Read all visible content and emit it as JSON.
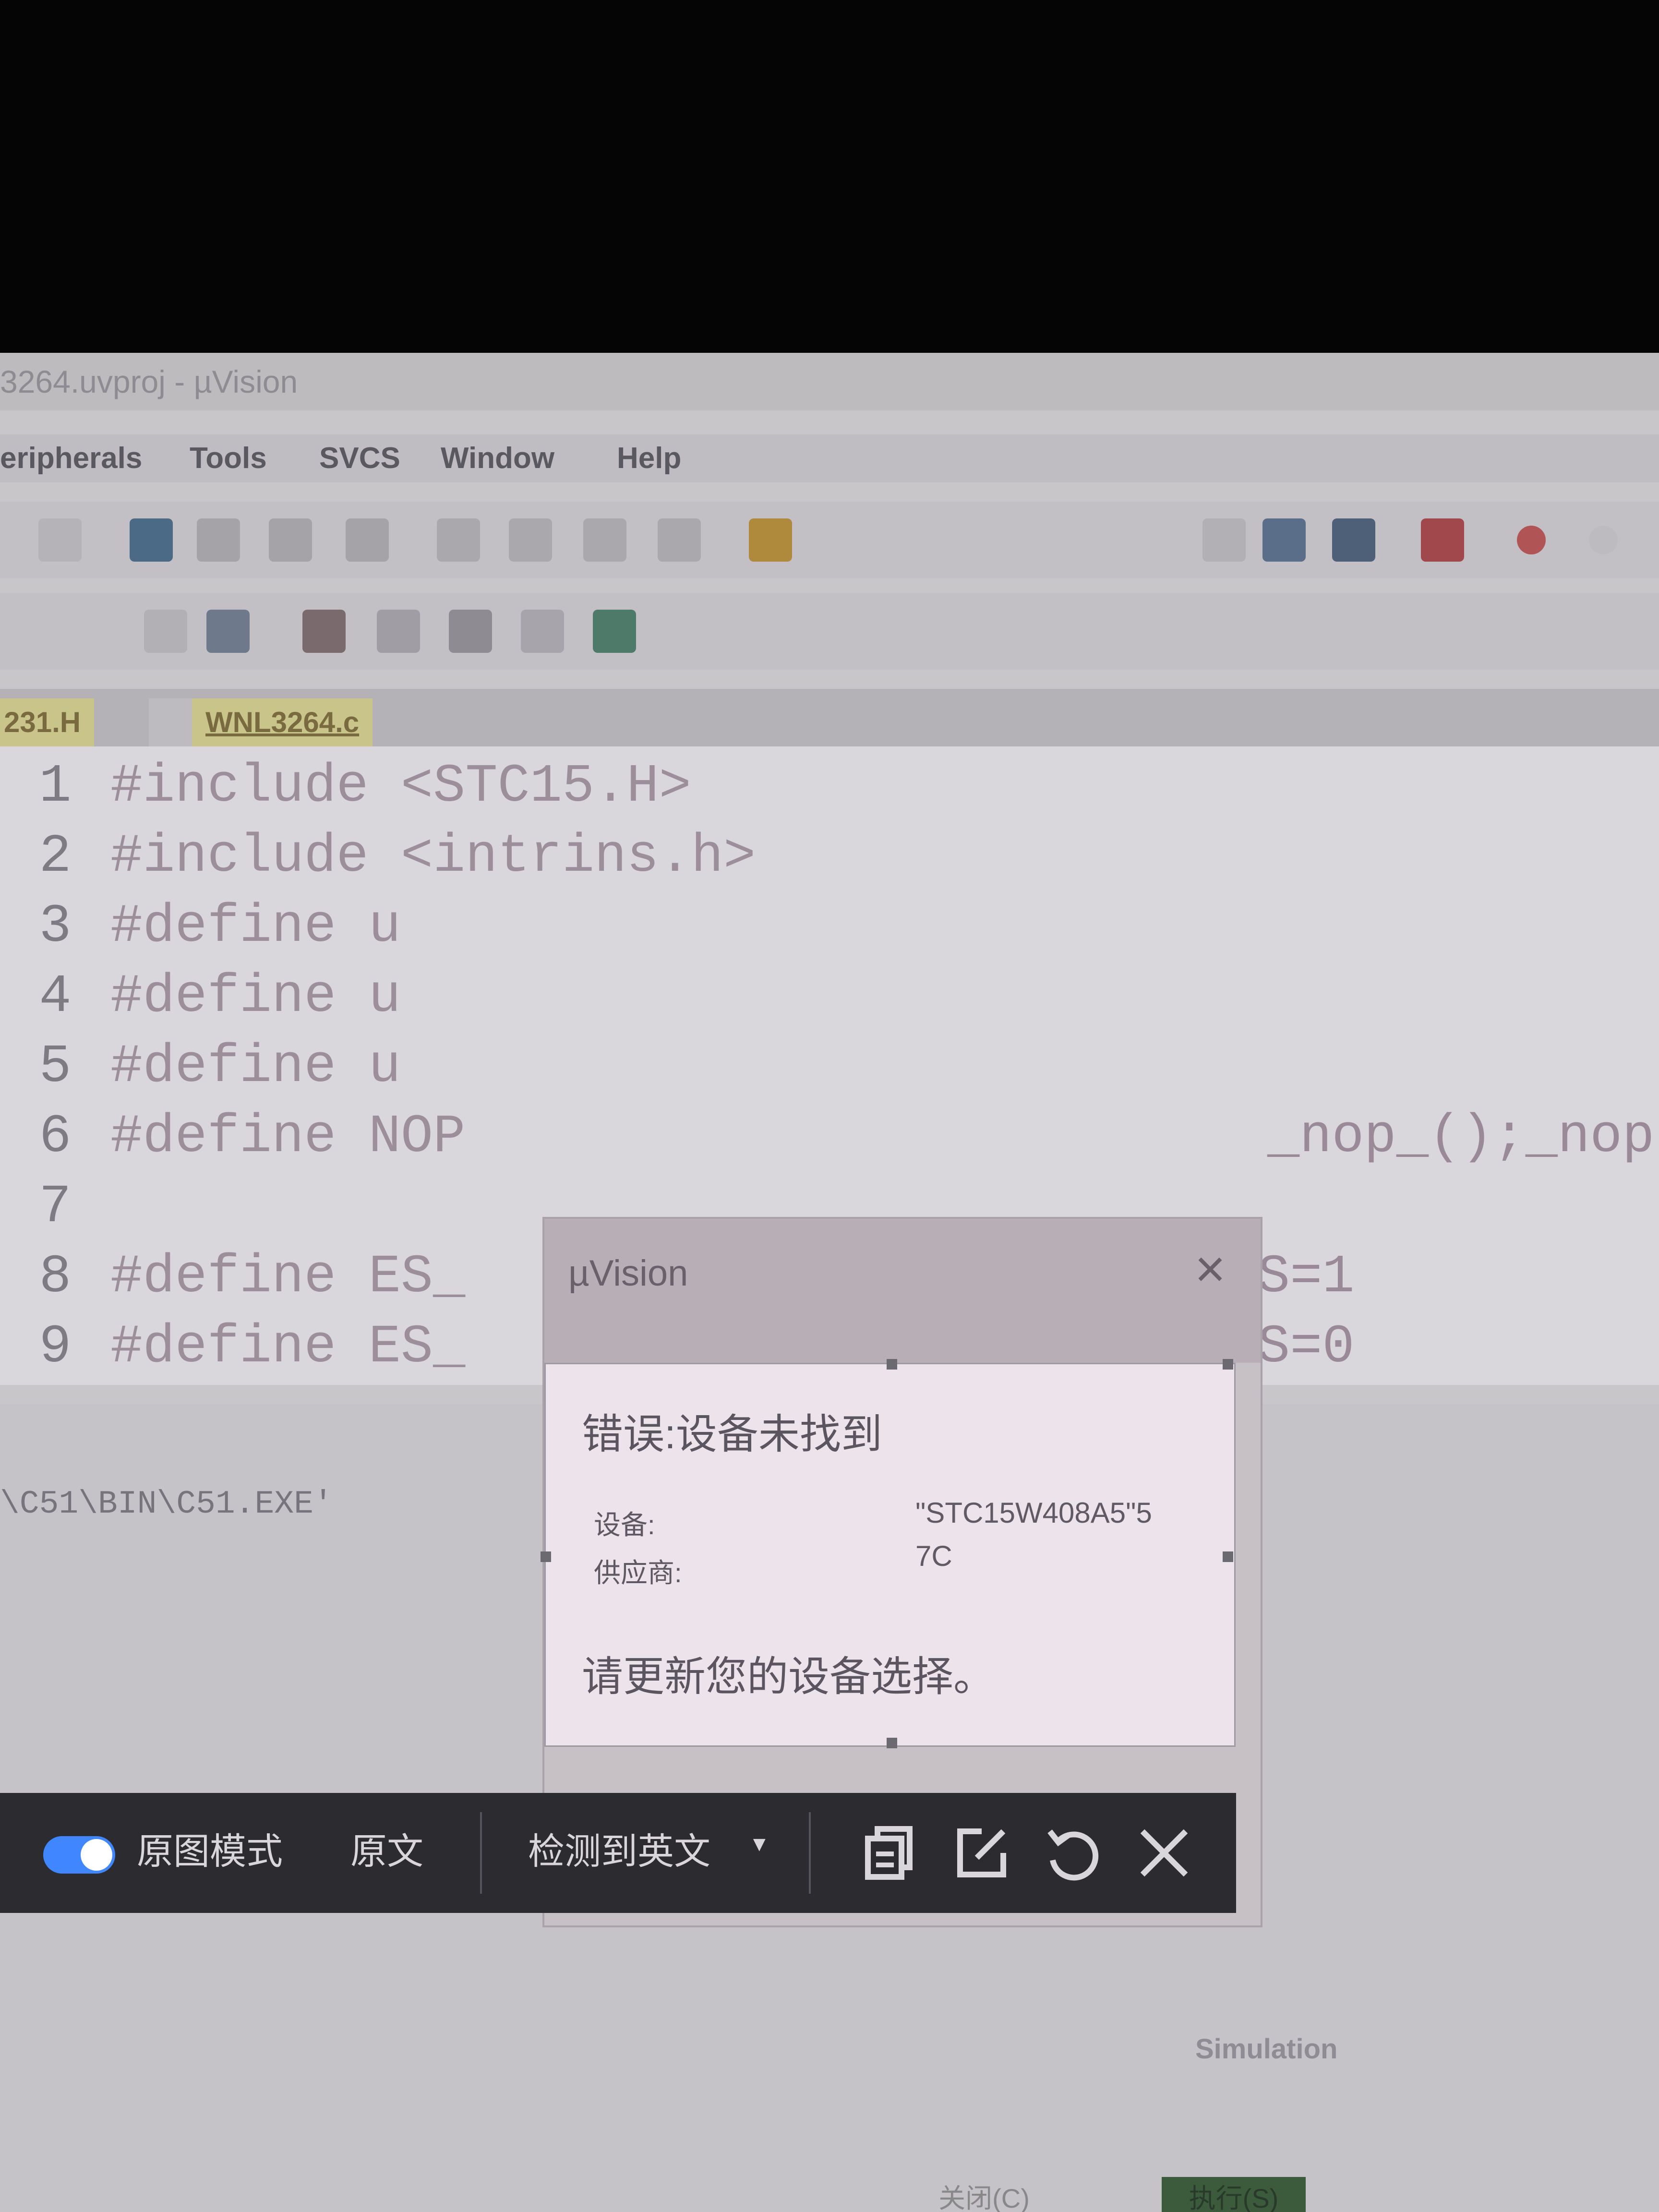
{
  "window": {
    "title": "3264.uvproj - µVision"
  },
  "menu": [
    {
      "label": "eripherals"
    },
    {
      "label": "Tools"
    },
    {
      "label": "SVCS"
    },
    {
      "label": "Window"
    },
    {
      "label": "Help"
    }
  ],
  "tabs": [
    {
      "label": "231.H"
    },
    {
      "label": "WNL3264.c"
    }
  ],
  "code_lines": [
    {
      "num": "1",
      "text": "#include <STC15.H>"
    },
    {
      "num": "2",
      "text": "#include <intrins.h>"
    },
    {
      "num": "3",
      "text": "#define    u"
    },
    {
      "num": "4",
      "text": "#define    u"
    },
    {
      "num": "5",
      "text": "#define    u"
    },
    {
      "num": "6",
      "text": "#define NOP"
    },
    {
      "num": "7",
      "text": ""
    },
    {
      "num": "8",
      "text": "#define ES_"
    },
    {
      "num": "9",
      "text": "#define ES_"
    }
  ],
  "code_right": {
    "line6": "_nop_();_nop",
    "line8": "S=1",
    "line9": "S=0"
  },
  "output": {
    "text": "\\C51\\BIN\\C51.EXE'",
    "simulation": "Simulation",
    "buttons": [
      "关闭(C)",
      "执行(S)"
    ]
  },
  "dialog": {
    "title": "µVision",
    "close": "×",
    "error_title": "错误:设备未找到",
    "device_label": "设备:",
    "vendor_label": "供应商:",
    "device_value_1": "\"STC15W408A5\"5",
    "device_value_2": "7C",
    "message": "请更新您的设备选择。"
  },
  "translation_bar": {
    "toggle_label": "原图模式",
    "original_label": "原文",
    "detect_label": "检测到英文",
    "accent": "#3f86ff"
  }
}
